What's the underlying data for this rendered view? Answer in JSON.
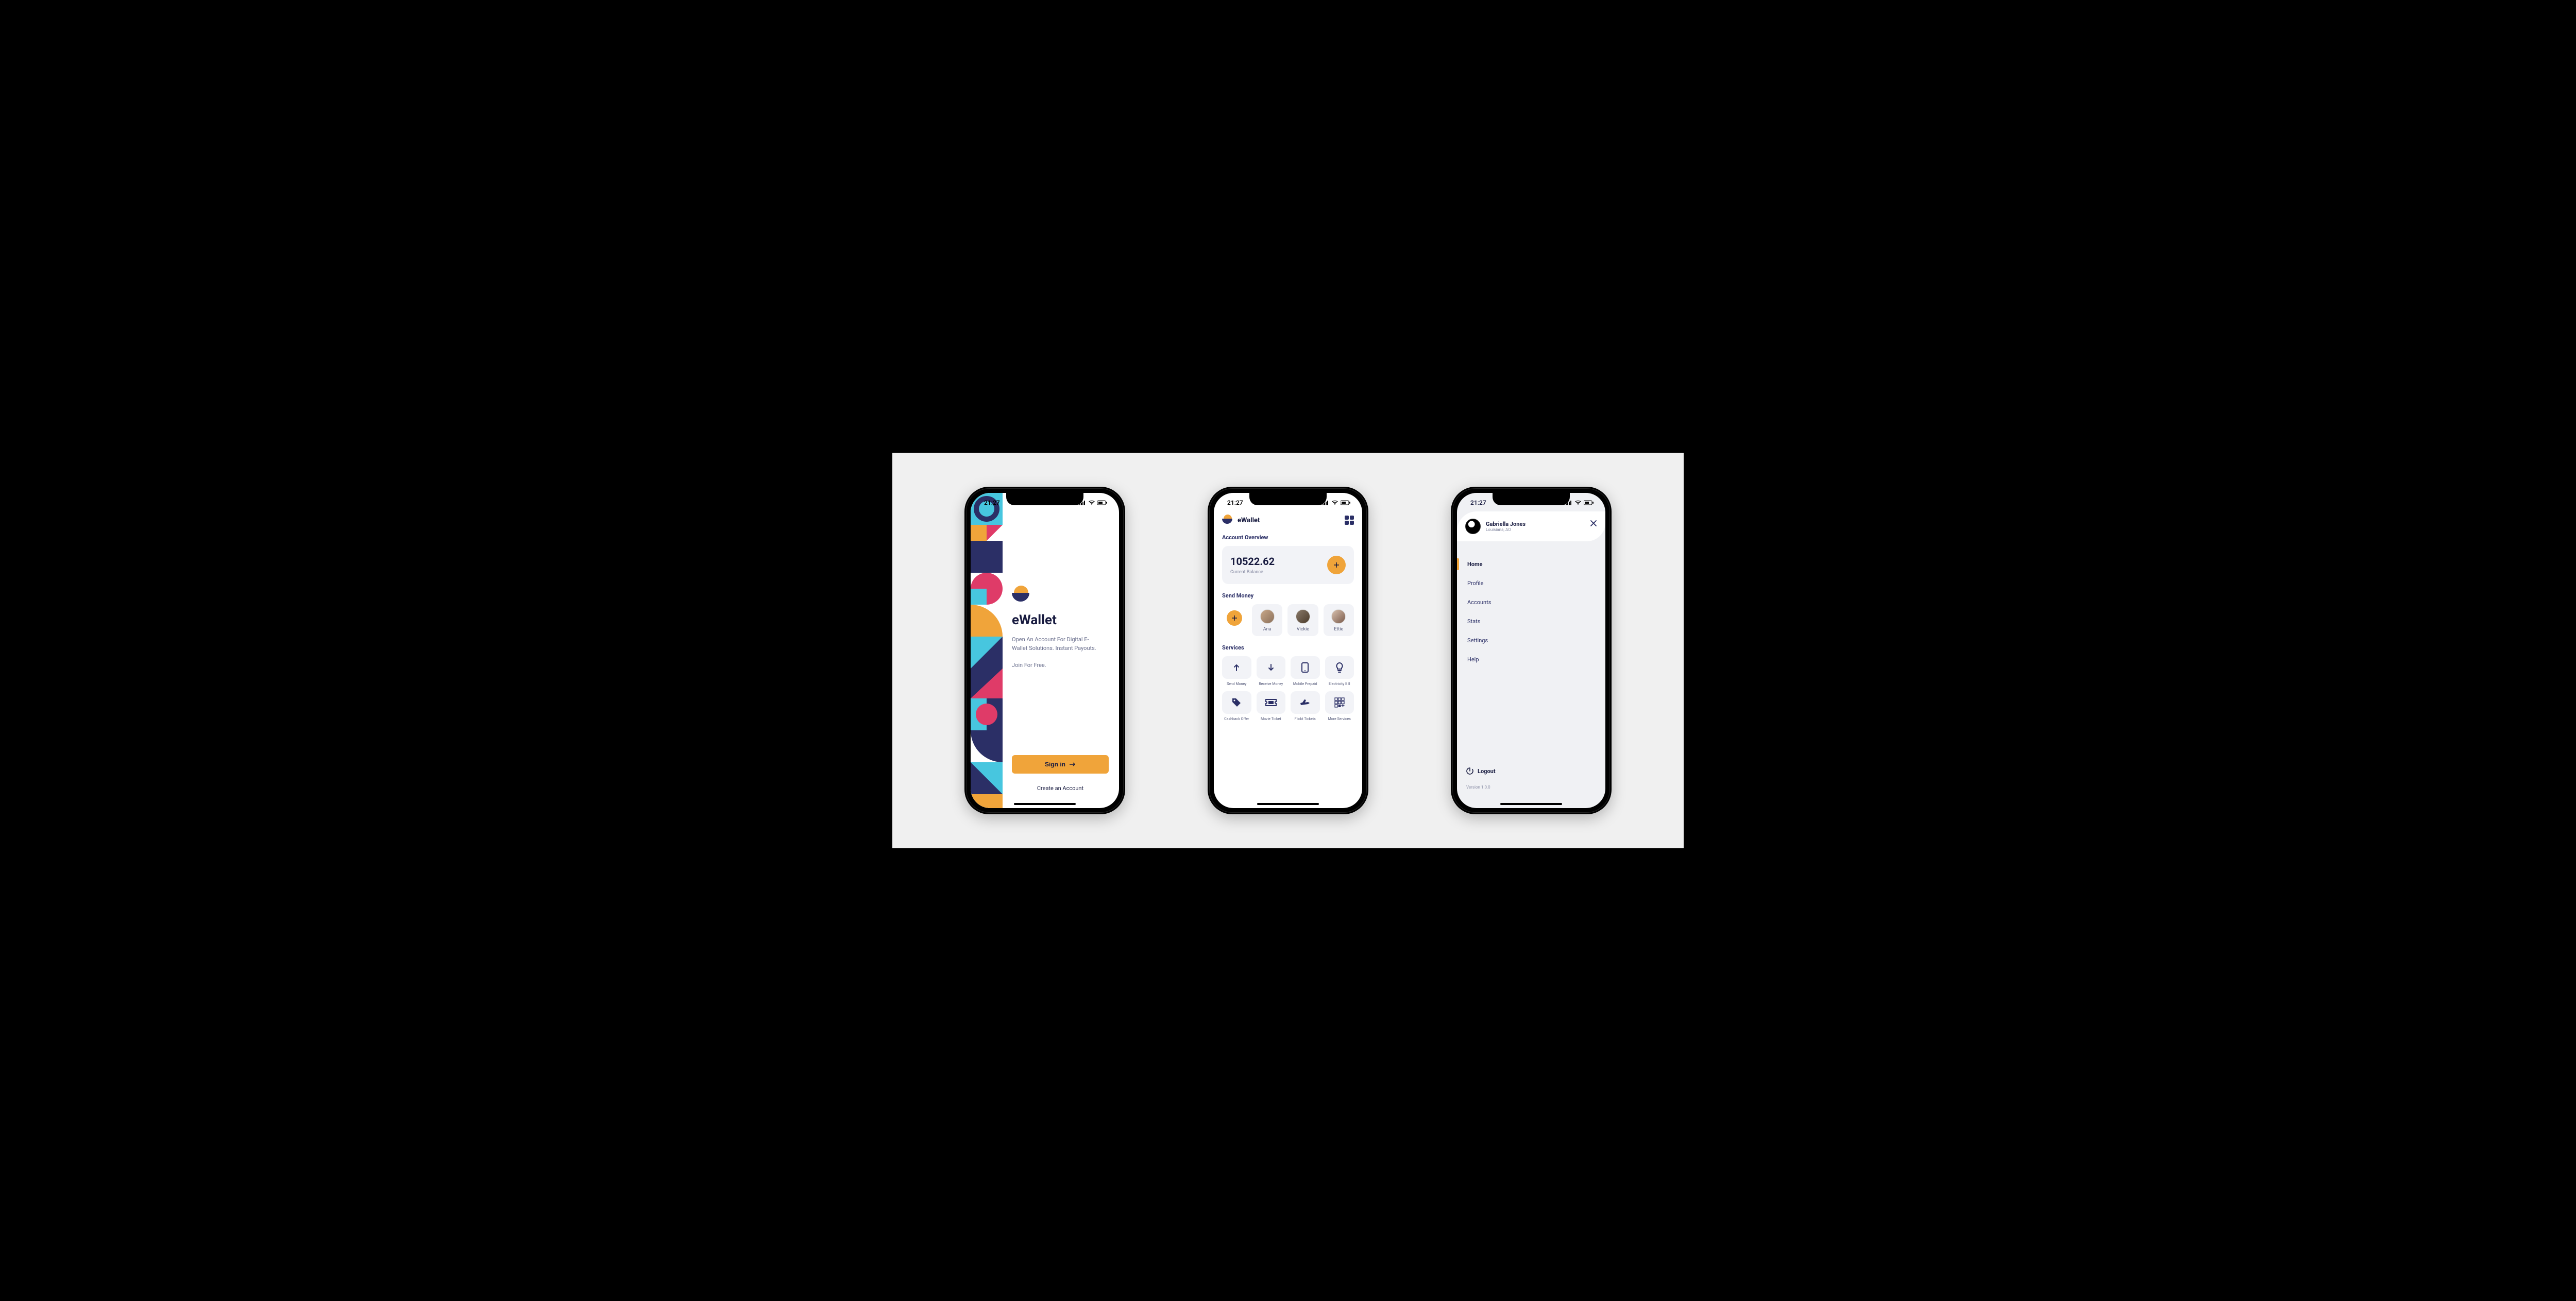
{
  "status": {
    "time": "21:27"
  },
  "screen1": {
    "app": "eWallet",
    "tagline": "Open An Account For Digital E-Wallet Solutions. Instant Payouts.",
    "subline": "Join For Free.",
    "signin": "Sign in",
    "create": "Create an Account"
  },
  "screen2": {
    "app": "eWallet",
    "overview_title": "Account Overview",
    "balance": "10522.62",
    "balance_label": "Current Balance",
    "send_title": "Send Money",
    "contacts": [
      "Ana",
      "Vickie",
      "Ettie"
    ],
    "services_title": "Services",
    "services": [
      "Send Money",
      "Receive Money",
      "Mobile Prepaid",
      "Electricity Bill",
      "Cashback Offer",
      "Movie Ticket",
      "Flickt Tickets",
      "More Services"
    ]
  },
  "screen3": {
    "name": "Gabriella Jones",
    "location": "Louisiana, AO",
    "menu": [
      "Home",
      "Profile",
      "Accounts",
      "Stats",
      "Settings",
      "Help"
    ],
    "active_index": 0,
    "logout": "Logout",
    "version": "Version 1.0.0"
  }
}
